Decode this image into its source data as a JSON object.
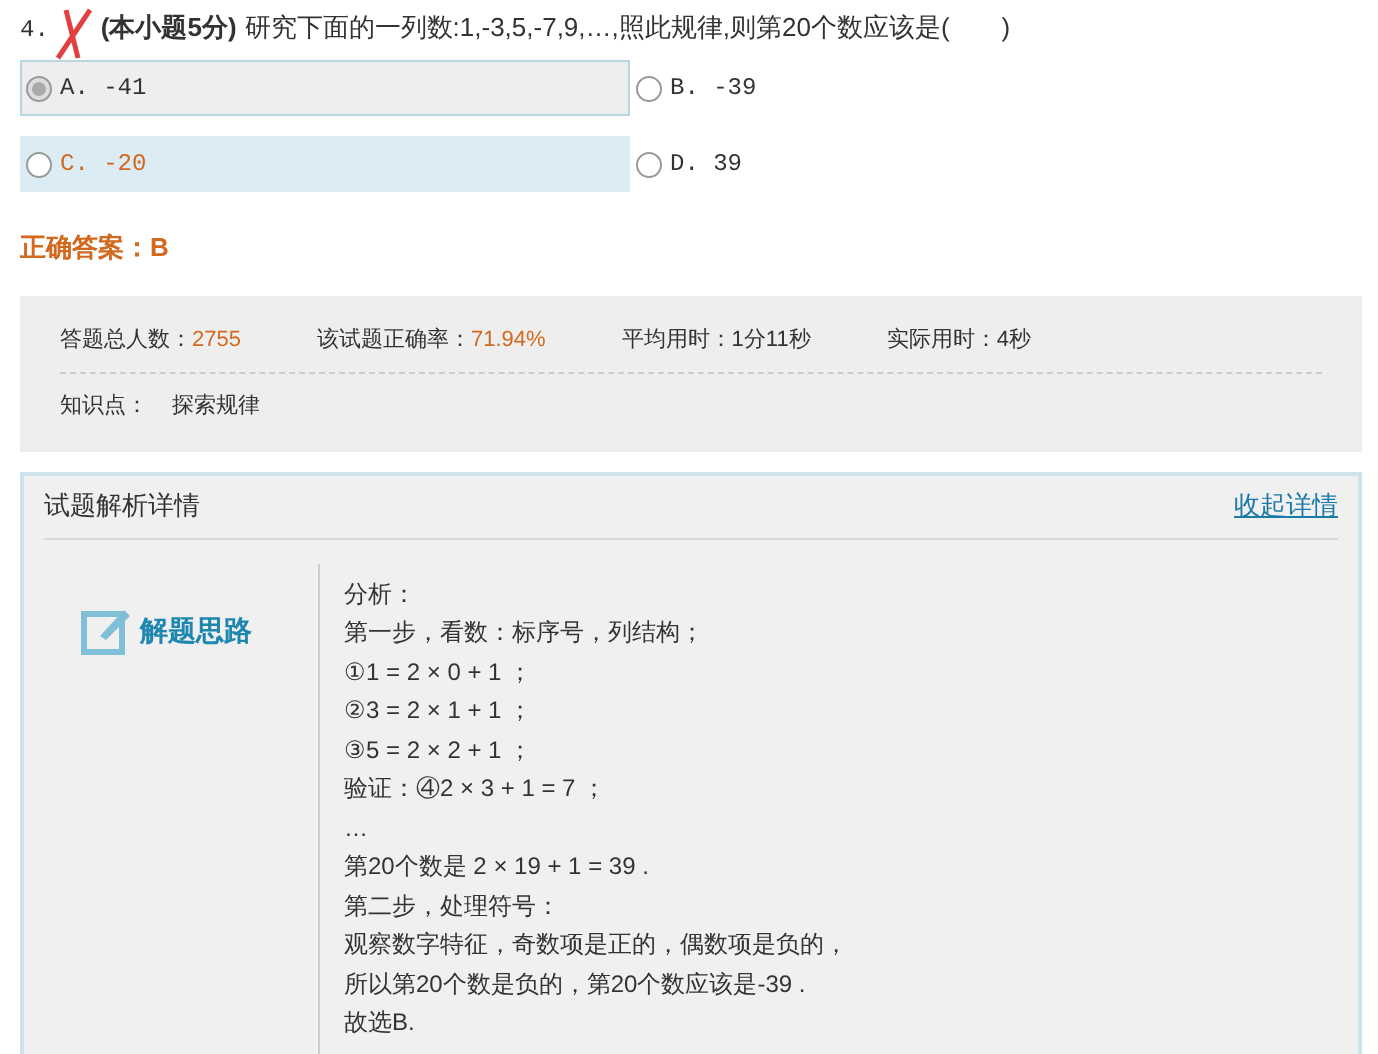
{
  "question": {
    "number": "4.",
    "score": "(本小题5分)",
    "text": "研究下面的一列数:1,-3,5,-7,9,…,照此规律,则第20个数应该是(　　)",
    "wrong": true
  },
  "options": [
    {
      "label": "A. -41",
      "selected": true,
      "highlighted": false
    },
    {
      "label": "B. -39",
      "selected": false,
      "highlighted": false
    },
    {
      "label": "C. -20",
      "selected": false,
      "highlighted": true
    },
    {
      "label": "D. 39",
      "selected": false,
      "highlighted": false
    }
  ],
  "answer": "正确答案：B",
  "stats": [
    {
      "label": "答题总人数：",
      "value": "2755",
      "accent": true
    },
    {
      "label": "该试题正确率：",
      "value": "71.94%",
      "accent": true
    },
    {
      "label": "平均用时：",
      "value": "1分11秒",
      "accent": false
    },
    {
      "label": "实际用时：",
      "value": "4秒",
      "accent": false
    }
  ],
  "knowledge": {
    "label": "知识点：",
    "value": "探索规律"
  },
  "details": {
    "title": "试题解析详情",
    "collapse_link": "收起详情",
    "section_title": "解题思路",
    "lines": [
      "分析：",
      "第一步，看数：标序号，列结构；",
      "①1 = 2 × 0 + 1 ；",
      "②3 = 2 × 1 + 1 ；",
      "③5 = 2 × 2 + 1 ；",
      "验证：④2 × 3 + 1 = 7 ；",
      "…",
      "第20个数是 2 × 19 + 1 = 39 .",
      "第二步，处理符号：",
      "观察数字特征，奇数项是正的，偶数项是负的，",
      "所以第20个数是负的，第20个数应该是-39 .",
      "故选B."
    ]
  }
}
